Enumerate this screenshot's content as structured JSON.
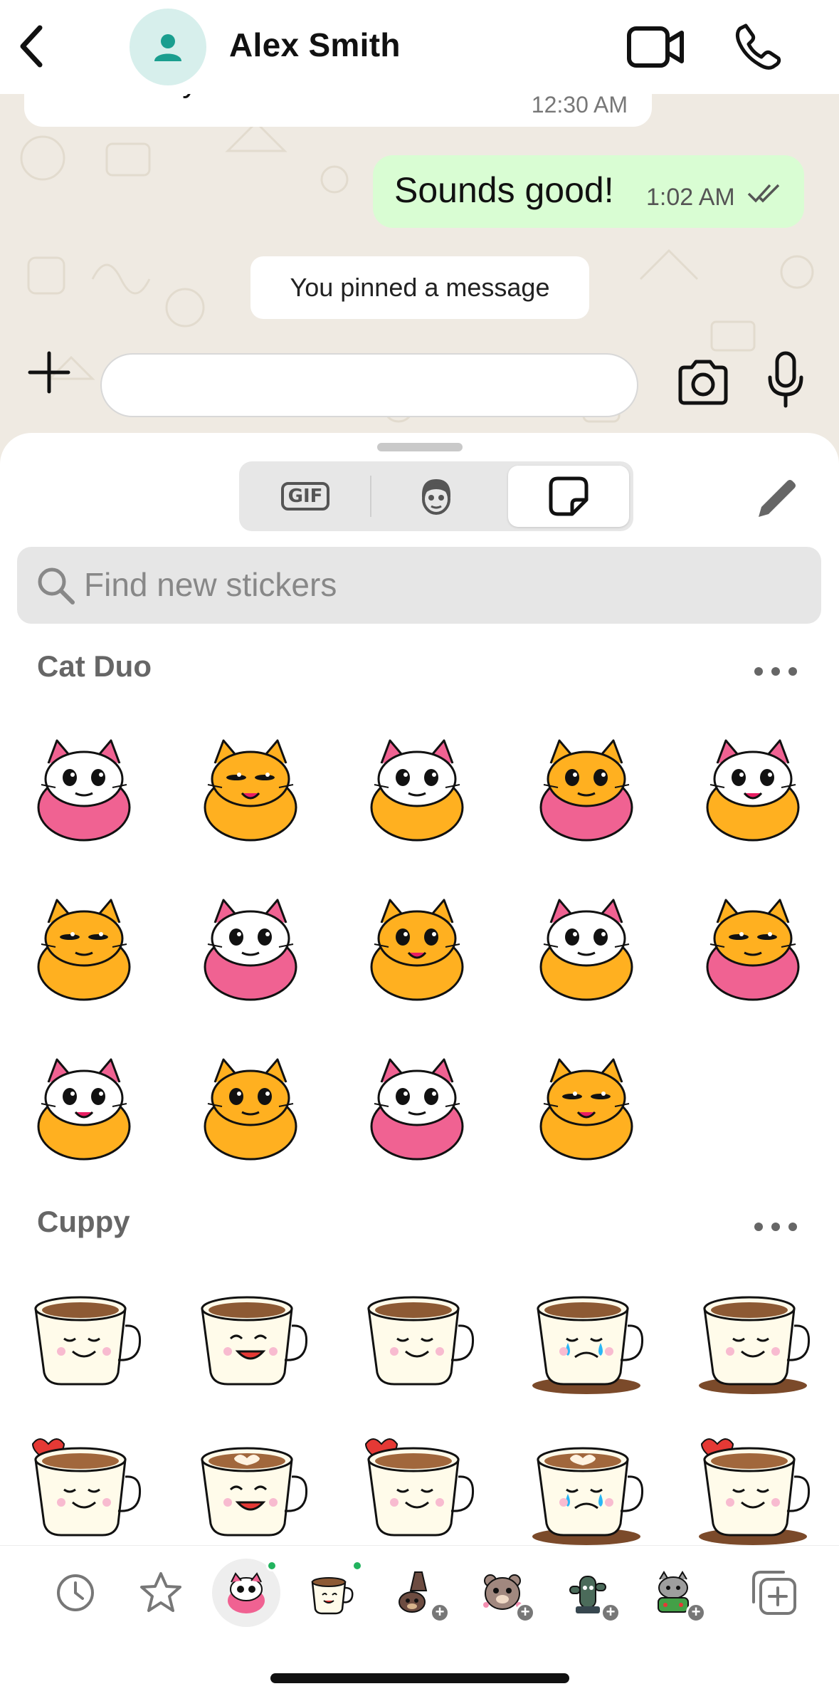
{
  "header": {
    "contact_name": "Alex Smith"
  },
  "chat": {
    "incoming": {
      "text": "whole day.",
      "time": "12:30 AM"
    },
    "outgoing": {
      "text": "Sounds good!",
      "time": "1:02 AM",
      "status": "read"
    },
    "system_message": "You pinned a message"
  },
  "composer": {
    "input_value": ""
  },
  "tray": {
    "tabs": [
      "GIF",
      "Avatar",
      "Stickers"
    ],
    "active_tab": "Stickers",
    "search_placeholder": "Find new stickers",
    "packs": [
      {
        "title": "Cat Duo",
        "sticker_count": 14
      },
      {
        "title": "Cuppy",
        "sticker_count": 10
      }
    ]
  },
  "pack_bar": {
    "items": [
      "recent-icon",
      "favorites-icon",
      "cat-duo-pack",
      "cuppy-pack",
      "bear-pack",
      "bear-2-pack",
      "cactus-pack",
      "cat-gamer-pack",
      "add-sticker-icon"
    ]
  },
  "colors": {
    "outgoing_bubble": "#d9fdd3",
    "chat_background": "#efeae2",
    "accent_green": "#22b35e",
    "sticker_pink": "#f06292",
    "sticker_orange": "#ffb020"
  }
}
